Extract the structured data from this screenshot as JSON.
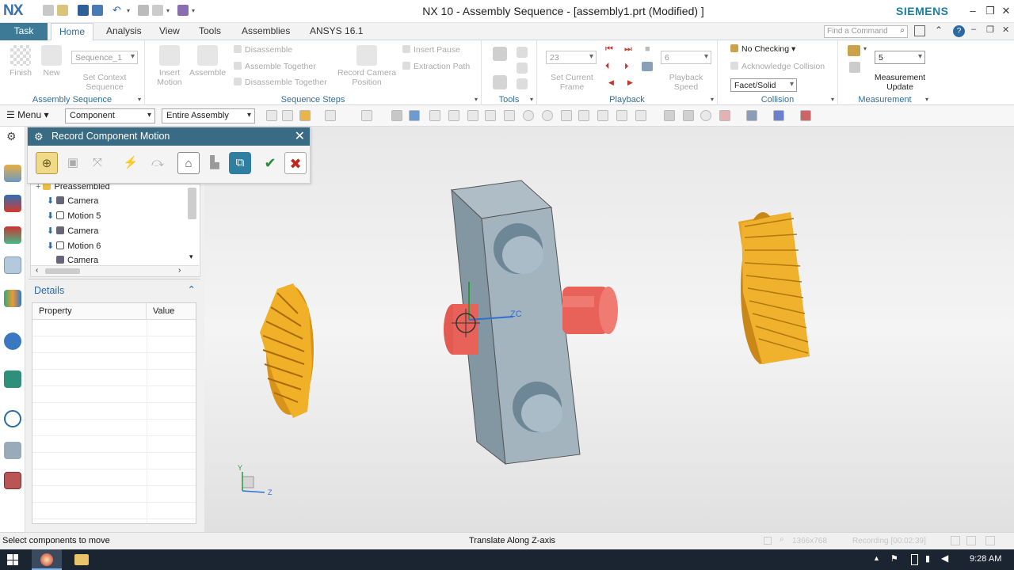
{
  "app": {
    "logo": "NX",
    "window_title": "NX 10 - Assembly Sequence - [assembly1.prt (Modified) ]",
    "brand": "SIEMENS",
    "window_controls": [
      "minimize-icon",
      "restore-icon",
      "close-icon"
    ]
  },
  "tabs": {
    "task": "Task",
    "items": [
      "Home",
      "Analysis",
      "View",
      "Tools",
      "Assemblies",
      "ANSYS 16.1"
    ],
    "active": "Home",
    "find_placeholder": "Find a Command"
  },
  "ribbon": {
    "assembly_sequence": {
      "label": "Assembly Sequence",
      "finish": "Finish",
      "new": "New",
      "sequence_value": "Sequence_1",
      "set_context": "Set Context Sequence"
    },
    "sequence_steps": {
      "label": "Sequence Steps",
      "insert_motion": "Insert Motion",
      "assemble": "Assemble",
      "disassemble": "Disassemble",
      "assemble_together": "Assemble Together",
      "disassemble_together": "Disassemble Together",
      "record_camera": "Record Camera Position",
      "insert_pause": "Insert Pause",
      "extraction_path": "Extraction Path"
    },
    "tools": {
      "label": "Tools"
    },
    "playback": {
      "label": "Playback",
      "frame_value": "23",
      "set_current_frame": "Set Current Frame",
      "speed_value": "6",
      "playback_speed": "Playback Speed"
    },
    "collision": {
      "label": "Collision",
      "checking": "No Checking",
      "acknowledge": "Acknowledge Collision",
      "mode": "Facet/Solid"
    },
    "measurement": {
      "label": "Measurement",
      "value": "5",
      "update": "Measurement Update"
    }
  },
  "toolbar": {
    "menu": "Menu",
    "filter": "Component",
    "scope": "Entire Assembly"
  },
  "dialog": {
    "title": "Record Component Motion"
  },
  "tree": {
    "items": [
      {
        "label": "Preassembled",
        "icon": "folder-icon"
      },
      {
        "label": "Camera",
        "icon": "camera-icon"
      },
      {
        "label": "Motion 5",
        "icon": "motion-icon"
      },
      {
        "label": "Camera",
        "icon": "camera-icon"
      },
      {
        "label": "Motion 6",
        "icon": "motion-icon"
      },
      {
        "label": "Camera",
        "icon": "camera-icon"
      }
    ]
  },
  "details": {
    "title": "Details",
    "col_property": "Property",
    "col_value": "Value"
  },
  "viewport": {
    "axis_zc": "ZC",
    "triad_y": "Y",
    "triad_z": "Z"
  },
  "status": {
    "left": "Select components to move",
    "center": "Translate Along Z-axis",
    "resolution": "1366x768",
    "recording": "Recording [00:02:39]"
  },
  "taskbar": {
    "time": "9:28 AM"
  },
  "colors": {
    "accent": "#3c7a96",
    "dialog_header": "#3a6b84",
    "gear": "#f0a81c",
    "block": "#9fb0bb",
    "shaft": "#e8625a"
  }
}
